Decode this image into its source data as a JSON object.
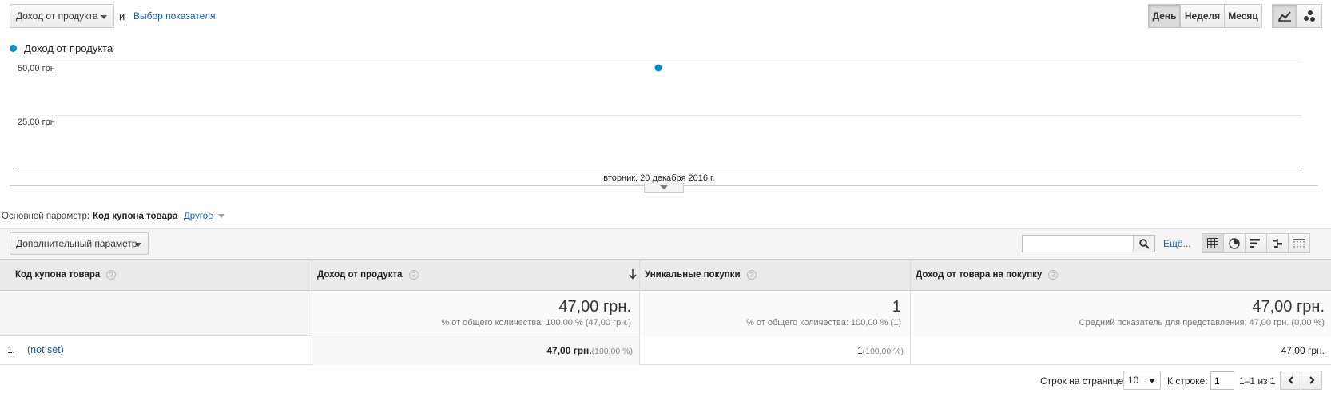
{
  "toolbar": {
    "metric_dropdown": "Доход от продукта",
    "and_text": "и",
    "select_metric_link": "Выбор показателя",
    "period_buttons": [
      "День",
      "Неделя",
      "Месяц"
    ],
    "active_period": "День"
  },
  "chart_data": {
    "type": "scatter",
    "series": [
      {
        "name": "Доход от продукта",
        "color": "#058dc7",
        "values": [
          47
        ]
      }
    ],
    "categories": [
      "вторник, 20 декабря 2016 г."
    ],
    "ytick_labels": [
      "50,00 грн",
      "25,00 грн"
    ],
    "ylim": [
      0,
      50
    ]
  },
  "dimension_bar": {
    "primary_label": "Основной параметр:",
    "primary_value": "Код купона товара",
    "other_label": "Другое",
    "secondary_dropdown": "Дополнительный параметр",
    "more_link": "Ещё..."
  },
  "table": {
    "headers": [
      "Код купона товара",
      "Доход от продукта",
      "Уникальные покупки",
      "Доход от товара на покупку"
    ],
    "totals": {
      "revenue": "47,00 грн.",
      "revenue_sub": "% от общего количества: 100,00 % (47,00 грн.)",
      "unique": "1",
      "unique_sub": "% от общего количества: 100,00 % (1)",
      "per_purchase": "47,00 грн.",
      "per_purchase_sub": "Средний показатель для представления: 47,00 грн. (0,00 %)"
    },
    "rows": [
      {
        "index": "1.",
        "coupon": "(not set)",
        "revenue": "47,00 грн.",
        "revenue_pct": "(100,00 %)",
        "unique": "1",
        "unique_pct": "(100,00 %)",
        "per_purchase": "47,00 грн."
      }
    ]
  },
  "pagination": {
    "rows_label": "Строк на странице:",
    "rows_value": "10",
    "goto_label": "К строке:",
    "goto_value": "1",
    "range": "1–1 из 1"
  },
  "colors": {
    "accent": "#058dc7",
    "link": "#1a5fa8"
  }
}
